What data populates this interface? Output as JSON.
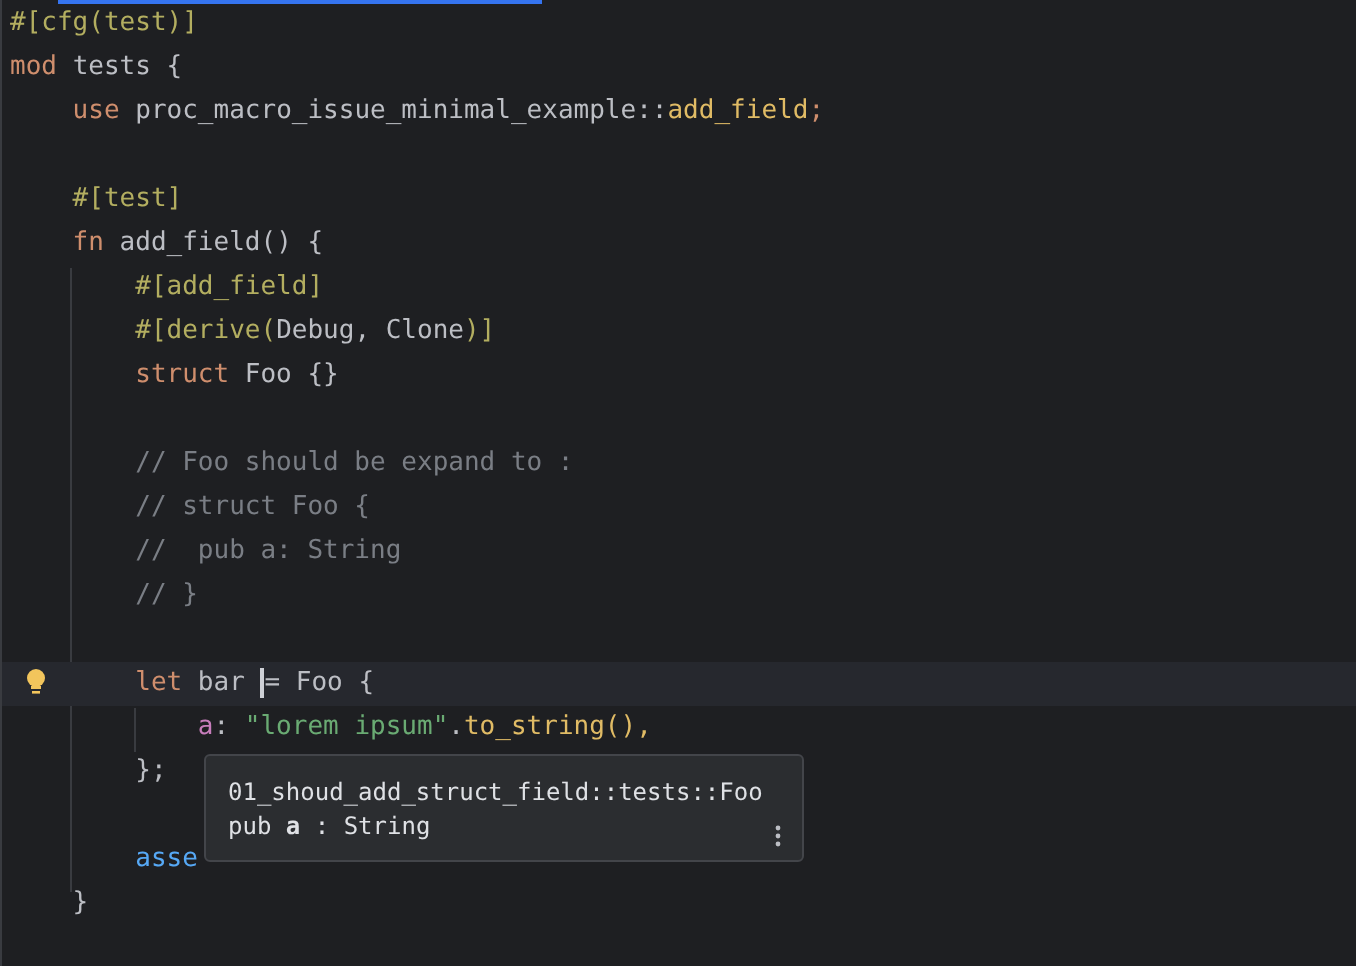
{
  "lines": [
    {
      "tokens": [
        {
          "text": "#[cfg(test)]",
          "kind": "attr"
        }
      ]
    },
    {
      "tokens": [
        {
          "text": "mod ",
          "kind": "keyword"
        },
        {
          "text": "tests {",
          "kind": "ident"
        }
      ]
    },
    {
      "tokens": [
        {
          "text": "    use ",
          "kind": "keyword"
        },
        {
          "text": "proc_macro_issue_minimal_example::",
          "kind": "ident"
        },
        {
          "text": "add_field",
          "kind": "macro_name"
        },
        {
          "text": ";",
          "kind": "keyword"
        }
      ]
    },
    {
      "gap_before": true,
      "tokens": [
        {
          "text": "    #[test]",
          "kind": "attr"
        }
      ]
    },
    {
      "tokens": [
        {
          "text": "    fn ",
          "kind": "keyword"
        },
        {
          "text": "add_field() {",
          "kind": "ident"
        }
      ]
    },
    {
      "tokens": [
        {
          "text": "        #[add_field]",
          "kind": "attr"
        }
      ]
    },
    {
      "tokens": [
        {
          "text": "        #[derive(",
          "kind": "attr"
        },
        {
          "text": "Debug, Clone",
          "kind": "ident"
        },
        {
          "text": ")]",
          "kind": "attr"
        }
      ]
    },
    {
      "tokens": [
        {
          "text": "        struct ",
          "kind": "keyword"
        },
        {
          "text": "Foo {}",
          "kind": "ident"
        }
      ]
    },
    {
      "gap_before": true,
      "tokens": [
        {
          "text": "        // Foo should be expand to :",
          "kind": "comment"
        }
      ]
    },
    {
      "tokens": [
        {
          "text": "        // struct Foo {",
          "kind": "comment"
        }
      ]
    },
    {
      "tokens": [
        {
          "text": "        //  pub a: String",
          "kind": "comment"
        }
      ]
    },
    {
      "tokens": [
        {
          "text": "        // }",
          "kind": "comment"
        }
      ]
    },
    {
      "gap_before": true,
      "current": true,
      "bulb": true,
      "tokens": [
        {
          "text": "        let ",
          "kind": "keyword"
        },
        {
          "text": "bar ",
          "kind": "ident"
        },
        {
          "text": "= Foo {",
          "kind": "ident",
          "caret_before": true
        }
      ]
    },
    {
      "tokens": [
        {
          "text": "            a",
          "kind": "field"
        },
        {
          "text": ": ",
          "kind": "ident"
        },
        {
          "text": "\"lorem ipsum\"",
          "kind": "string"
        },
        {
          "text": ".",
          "kind": "ident"
        },
        {
          "text": "to_string(),",
          "kind": "macro_name"
        }
      ]
    },
    {
      "tokens": [
        {
          "text": "        };",
          "kind": "ident"
        }
      ]
    },
    {
      "gap_before": true,
      "tokens": [
        {
          "text": "        asse",
          "kind": "macro"
        }
      ]
    },
    {
      "tokens": [
        {
          "text": "    }",
          "kind": "ident"
        }
      ]
    }
  ],
  "tooltip": {
    "path": "01_shoud_add_struct_field::tests::Foo",
    "signature": "pub **a** : String"
  }
}
